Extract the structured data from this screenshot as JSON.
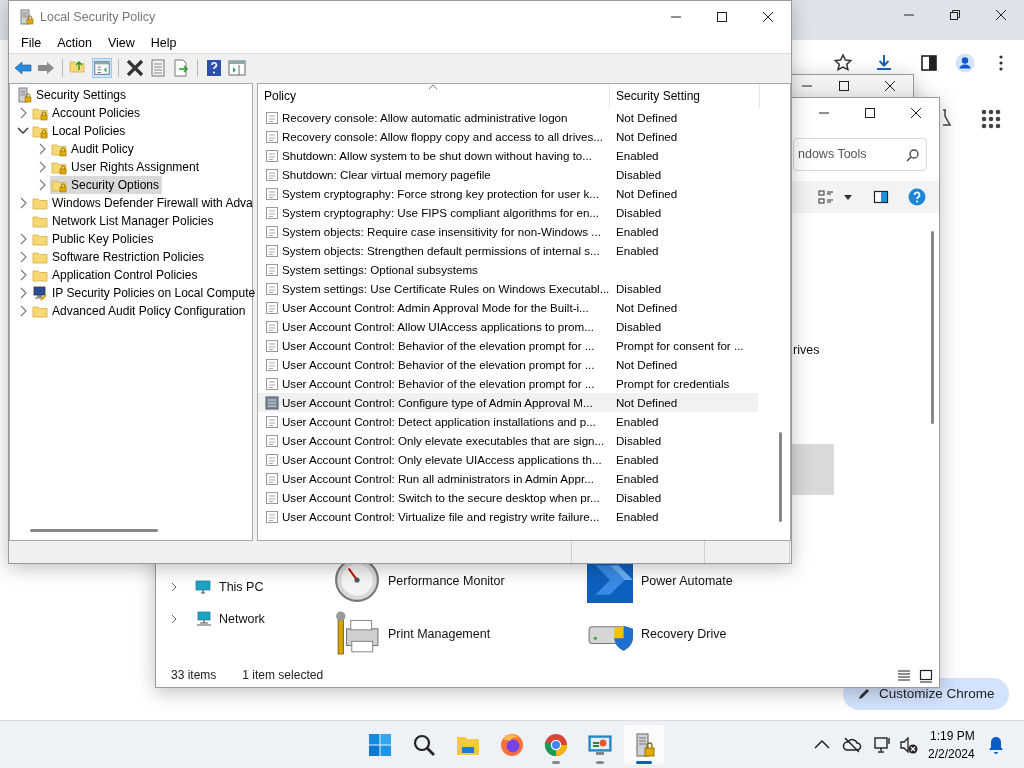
{
  "browser": {
    "customize_button": "Customize Chrome"
  },
  "explorer": {
    "search": {
      "value": "ndows Tools"
    },
    "partial_item": "rives",
    "nav": [
      {
        "label": "This PC",
        "kind": "pc"
      },
      {
        "label": "Network",
        "kind": "network"
      }
    ],
    "items": [
      {
        "label": "Performance Monitor",
        "kind": "gauge"
      },
      {
        "label": "Power Automate",
        "kind": "automate"
      },
      {
        "label": "Print Management",
        "kind": "printer"
      },
      {
        "label": "Recovery Drive",
        "kind": "drive"
      }
    ],
    "status": {
      "count": "33 items",
      "selection": "1 item selected"
    }
  },
  "window": {
    "title": "Local Security Policy",
    "menu": [
      "File",
      "Action",
      "View",
      "Help"
    ],
    "tree": {
      "label": "Security Settings",
      "children": [
        {
          "label": "Account Policies",
          "kind": "locked-folder",
          "expanded": false,
          "selected": false
        },
        {
          "label": "Local Policies",
          "kind": "locked-folder",
          "expanded": true,
          "selected": false,
          "children": [
            {
              "label": "Audit Policy",
              "kind": "locked-folder",
              "expanded": false,
              "selected": false
            },
            {
              "label": "User Rights Assignment",
              "kind": "locked-folder",
              "expanded": false,
              "selected": false
            },
            {
              "label": "Security Options",
              "kind": "locked-folder",
              "expanded": false,
              "selected": true
            }
          ]
        },
        {
          "label": "Windows Defender Firewall with Adva",
          "kind": "folder",
          "expanded": false,
          "selected": false
        },
        {
          "label": "Network List Manager Policies",
          "kind": "folder",
          "selected": false
        },
        {
          "label": "Public Key Policies",
          "kind": "folder",
          "expanded": false,
          "selected": false
        },
        {
          "label": "Software Restriction Policies",
          "kind": "folder",
          "expanded": false,
          "selected": false
        },
        {
          "label": "Application Control Policies",
          "kind": "folder",
          "expanded": false,
          "selected": false
        },
        {
          "label": "IP Security Policies on Local Compute",
          "kind": "ip-security",
          "expanded": false,
          "selected": false
        },
        {
          "label": "Advanced Audit Policy Configuration",
          "kind": "folder",
          "expanded": false,
          "selected": false
        }
      ]
    },
    "columns": [
      "Policy",
      "Security Setting"
    ],
    "rows": [
      {
        "policy": "Recovery console: Allow automatic administrative logon",
        "setting": "Not Defined",
        "selected": false
      },
      {
        "policy": "Recovery console: Allow floppy copy and access to all drives...",
        "setting": "Not Defined",
        "selected": false
      },
      {
        "policy": "Shutdown: Allow system to be shut down without having to...",
        "setting": "Enabled",
        "selected": false
      },
      {
        "policy": "Shutdown: Clear virtual memory pagefile",
        "setting": "Disabled",
        "selected": false
      },
      {
        "policy": "System cryptography: Force strong key protection for user k...",
        "setting": "Not Defined",
        "selected": false
      },
      {
        "policy": "System cryptography: Use FIPS compliant algorithms for en...",
        "setting": "Disabled",
        "selected": false
      },
      {
        "policy": "System objects: Require case insensitivity for non-Windows ...",
        "setting": "Enabled",
        "selected": false
      },
      {
        "policy": "System objects: Strengthen default permissions of internal s...",
        "setting": "Enabled",
        "selected": false
      },
      {
        "policy": "System settings: Optional subsystems",
        "selected": false
      },
      {
        "policy": "System settings: Use Certificate Rules on Windows Executabl...",
        "setting": "Disabled",
        "selected": false
      },
      {
        "policy": "User Account Control: Admin Approval Mode for the Built-i...",
        "setting": "Not Defined",
        "selected": false
      },
      {
        "policy": "User Account Control: Allow UIAccess applications to prom...",
        "setting": "Disabled",
        "selected": false
      },
      {
        "policy": "User Account Control: Behavior of the elevation prompt for ...",
        "setting": "Prompt for consent for ...",
        "selected": false
      },
      {
        "policy": "User Account Control: Behavior of the elevation prompt for ...",
        "setting": "Not Defined",
        "selected": false
      },
      {
        "policy": "User Account Control: Behavior of the elevation prompt for ...",
        "setting": "Prompt for credentials",
        "selected": false
      },
      {
        "policy": "User Account Control: Configure type of Admin Approval M...",
        "setting": "Not Defined",
        "selected": true
      },
      {
        "policy": "User Account Control: Detect application installations and p...",
        "setting": "Enabled",
        "selected": false
      },
      {
        "policy": "User Account Control: Only elevate executables that are sign...",
        "setting": "Disabled",
        "selected": false
      },
      {
        "policy": "User Account Control: Only elevate UIAccess applications th...",
        "setting": "Enabled",
        "selected": false
      },
      {
        "policy": "User Account Control: Run all administrators in Admin Appr...",
        "setting": "Enabled",
        "selected": false
      },
      {
        "policy": "User Account Control: Switch to the secure desktop when pr...",
        "setting": "Disabled",
        "selected": false
      },
      {
        "policy": "User Account Control: Virtualize file and registry write failure...",
        "setting": "Enabled",
        "selected": false
      }
    ]
  },
  "taskbar": {
    "apps": [
      {
        "kind": "start",
        "running": false,
        "active": false
      },
      {
        "kind": "search",
        "running": false,
        "active": false
      },
      {
        "kind": "files",
        "running": false,
        "active": false
      },
      {
        "kind": "firefox",
        "running": false,
        "active": false
      },
      {
        "kind": "chrome",
        "running": true,
        "active": false
      },
      {
        "kind": "control-panel",
        "running": true,
        "active": false
      },
      {
        "kind": "security-policy",
        "running": true,
        "active": true
      }
    ],
    "time": "1:19 PM",
    "date": "2/2/2024"
  }
}
